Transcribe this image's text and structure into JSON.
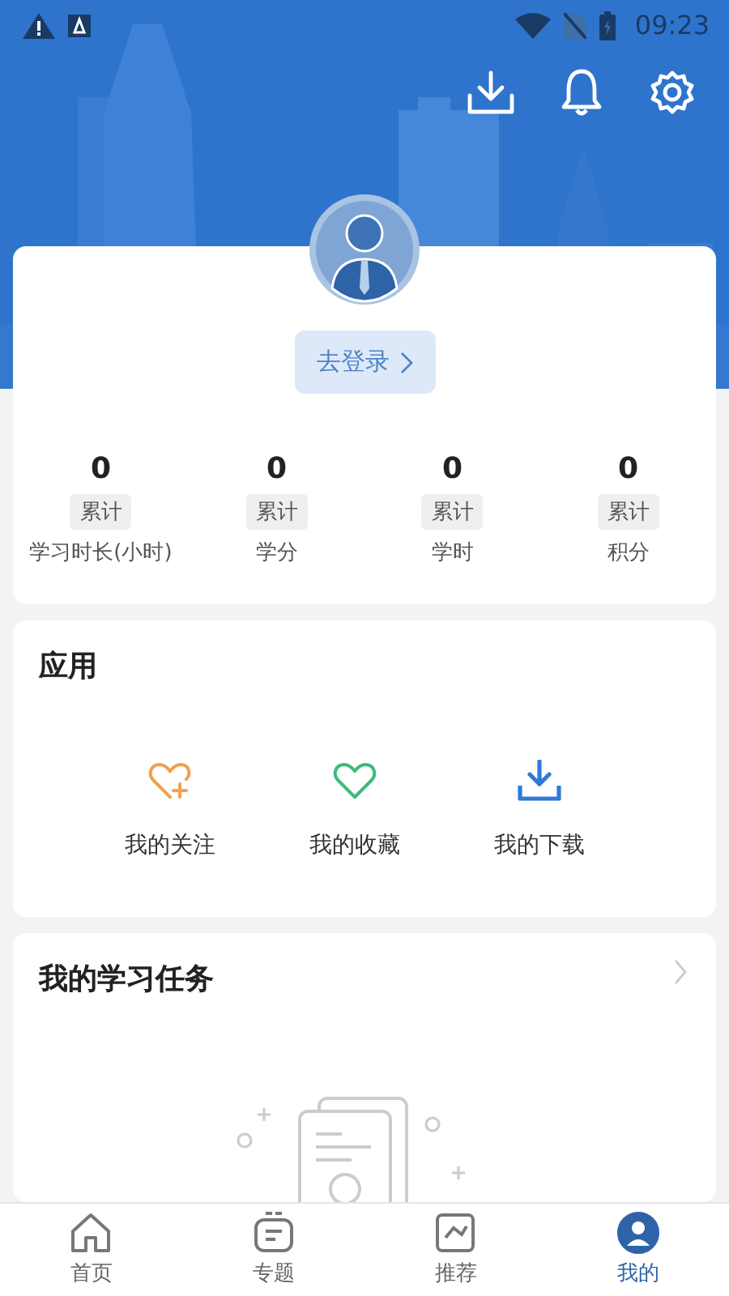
{
  "status_bar": {
    "time": "09:23"
  },
  "profile": {
    "login_button": "去登录",
    "stats": [
      {
        "value": "0",
        "badge": "累计",
        "label": "学习时长(小时)"
      },
      {
        "value": "0",
        "badge": "累计",
        "label": "学分"
      },
      {
        "value": "0",
        "badge": "累计",
        "label": "学时"
      },
      {
        "value": "0",
        "badge": "累计",
        "label": "积分"
      }
    ]
  },
  "apps": {
    "title": "应用",
    "items": [
      {
        "kind": "follow",
        "label": "我的关注"
      },
      {
        "kind": "favorite",
        "label": "我的收藏"
      },
      {
        "kind": "download",
        "label": "我的下载"
      }
    ]
  },
  "tasks": {
    "title": "我的学习任务"
  },
  "tabs": [
    {
      "kind": "home",
      "label": "首页",
      "selected": false
    },
    {
      "kind": "topic",
      "label": "专题",
      "selected": false
    },
    {
      "kind": "recommend",
      "label": "推荐",
      "selected": false
    },
    {
      "kind": "mine",
      "label": "我的",
      "selected": true
    }
  ]
}
